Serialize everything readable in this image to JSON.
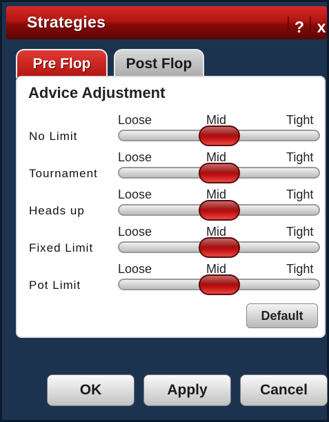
{
  "window": {
    "title": "Strategies",
    "help_label": "?",
    "close_label": "x"
  },
  "tabs": [
    {
      "label": "Pre Flop",
      "active": true
    },
    {
      "label": "Post Flop",
      "active": false
    }
  ],
  "panel": {
    "heading": "Advice Adjustment",
    "scale_labels": {
      "loose": "Loose",
      "mid": "Mid",
      "tight": "Tight"
    },
    "sliders": [
      {
        "name": "No Limit",
        "value": 0.5
      },
      {
        "name": "Tournament",
        "value": 0.5
      },
      {
        "name": "Heads up",
        "value": 0.5
      },
      {
        "name": "Fixed Limit",
        "value": 0.5
      },
      {
        "name": "Pot Limit",
        "value": 0.5
      }
    ],
    "default_label": "Default"
  },
  "buttons": {
    "ok": "OK",
    "apply": "Apply",
    "cancel": "Cancel"
  },
  "colors": {
    "accent": "#b01612",
    "background": "#1c3350",
    "panel": "#ffffff"
  }
}
